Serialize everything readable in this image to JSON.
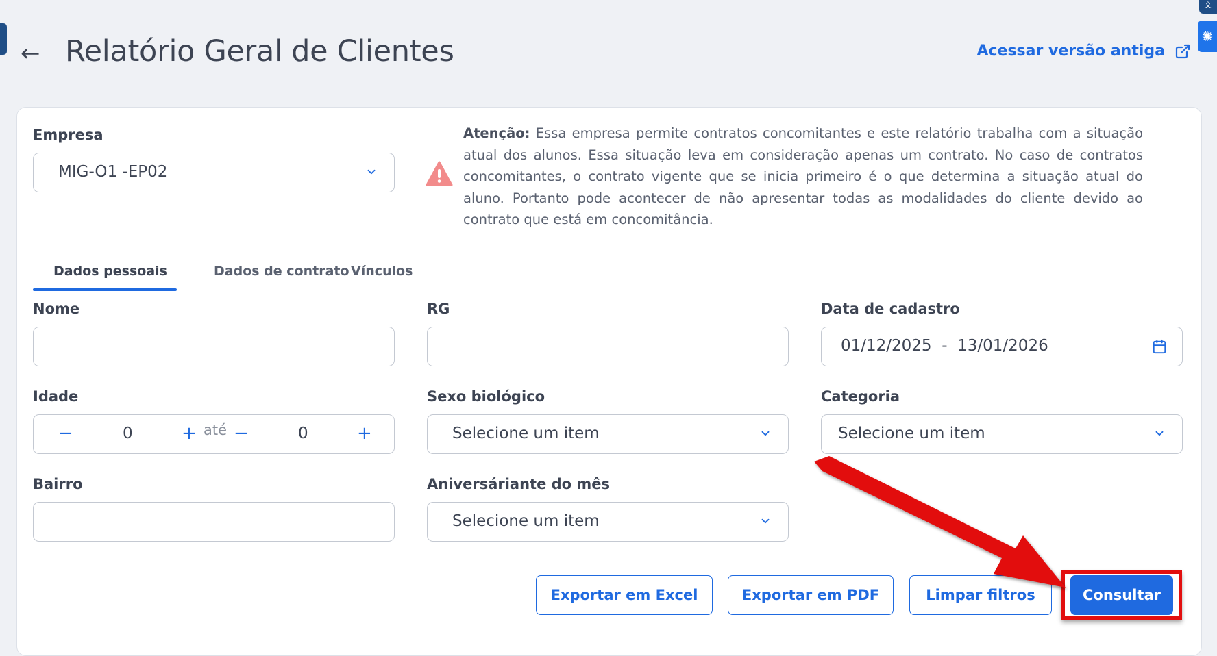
{
  "header": {
    "title": "Relatório Geral de Clientes",
    "old_version_link": "Acessar versão antiga"
  },
  "empresa": {
    "label": "Empresa",
    "value": "MIG-O1 -EP02"
  },
  "notice": {
    "prefix": "Atenção:",
    "text": " Essa empresa permite contratos concomitantes e este relatório trabalha com a situação atual dos alunos. Essa situação leva em consideração apenas um contrato. No caso de contratos concomitantes, o contrato vigente que se inicia primeiro é o que determina a situação atual do aluno. Portanto pode acontecer de não apresentar todas as modalidades do cliente devido ao contrato que está em concomitância."
  },
  "tabs": [
    {
      "label": "Dados pessoais",
      "active": true
    },
    {
      "label": "Dados de contrato",
      "active": false
    },
    {
      "label": "Vínculos",
      "active": false
    }
  ],
  "form": {
    "nome": {
      "label": "Nome",
      "value": ""
    },
    "rg": {
      "label": "RG",
      "value": ""
    },
    "data_cadastro": {
      "label": "Data de cadastro",
      "start": "01/12/2025",
      "separator": "-",
      "end": "13/01/2026"
    },
    "idade": {
      "label": "Idade",
      "min": "0",
      "max": "0",
      "between": "até"
    },
    "sexo": {
      "label": "Sexo biológico",
      "placeholder": "Selecione um item"
    },
    "categoria": {
      "label": "Categoria",
      "placeholder": "Selecione um item"
    },
    "bairro": {
      "label": "Bairro",
      "value": ""
    },
    "aniversariante": {
      "label": "Aniversáriante do mês",
      "placeholder": "Selecione um item"
    }
  },
  "buttons": {
    "excel": "Exportar em Excel",
    "pdf": "Exportar em PDF",
    "clear": "Limpar filtros",
    "submit": "Consultar"
  },
  "colors": {
    "primary": "#1f6ae0",
    "annotation": "#e20f0f",
    "warning_icon": "#f28b8b"
  }
}
